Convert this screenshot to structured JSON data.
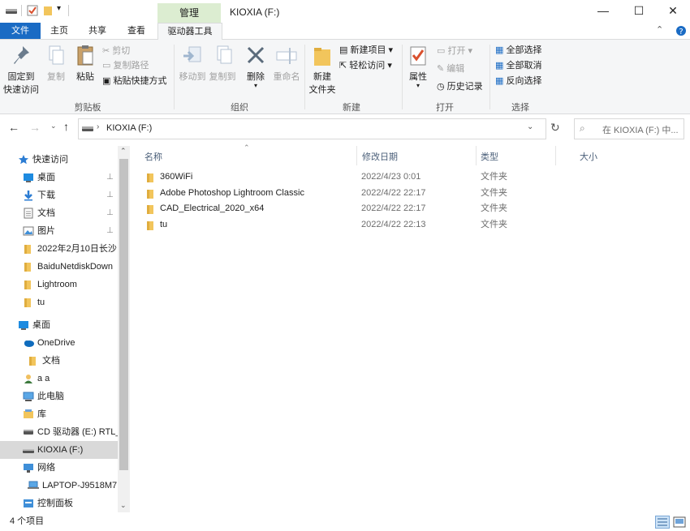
{
  "window": {
    "title": "KIOXIA (F:)",
    "context_tab": "管理"
  },
  "tabs": {
    "file": "文件",
    "home": "主页",
    "share": "共享",
    "view": "查看",
    "drive_tools": "驱动器工具"
  },
  "ribbon": {
    "clipboard": {
      "group": "剪贴板",
      "pin": "固定到\n快速访问",
      "pin_line1": "固定到",
      "pin_line2": "快速访问",
      "copy": "复制",
      "paste": "粘贴",
      "cut": "剪切",
      "copy_path": "复制路径",
      "paste_shortcut": "粘贴快捷方式"
    },
    "organize": {
      "group": "组织",
      "move_to": "移动到",
      "copy_to": "复制到",
      "delete": "删除",
      "rename": "重命名"
    },
    "new": {
      "group": "新建",
      "new_folder_line1": "新建",
      "new_folder_line2": "文件夹",
      "new_item": "新建项目",
      "easy_access": "轻松访问"
    },
    "open": {
      "group": "打开",
      "properties": "属性",
      "open": "打开",
      "edit": "编辑",
      "history": "历史记录"
    },
    "select": {
      "group": "选择",
      "select_all": "全部选择",
      "select_none": "全部取消",
      "invert": "反向选择"
    }
  },
  "address": {
    "path": "KIOXIA (F:)",
    "search_placeholder": "在 KIOXIA (F:) 中..."
  },
  "sidebar": {
    "items": [
      {
        "label": "快速访问",
        "icon": "star-icon"
      },
      {
        "label": "桌面",
        "icon": "desktop-icon"
      },
      {
        "label": "下载",
        "icon": "download-icon"
      },
      {
        "label": "文档",
        "icon": "document-icon"
      },
      {
        "label": "图片",
        "icon": "picture-icon"
      },
      {
        "label": "2022年2月10日长沙",
        "icon": "folder-icon"
      },
      {
        "label": "BaiduNetdiskDown",
        "icon": "folder-icon"
      },
      {
        "label": "Lightroom",
        "icon": "folder-icon"
      },
      {
        "label": "tu",
        "icon": "folder-icon"
      },
      {
        "label": "桌面",
        "icon": "desktop-icon"
      },
      {
        "label": "OneDrive",
        "icon": "cloud-icon"
      },
      {
        "label": "文档",
        "icon": "folder-icon"
      },
      {
        "label": "a a",
        "icon": "user-icon"
      },
      {
        "label": "此电脑",
        "icon": "computer-icon"
      },
      {
        "label": "库",
        "icon": "library-icon"
      },
      {
        "label": "CD 驱动器 (E:) RTL_",
        "icon": "cd-icon"
      },
      {
        "label": "KIOXIA (F:)",
        "icon": "drive-icon"
      },
      {
        "label": "网络",
        "icon": "network-icon"
      },
      {
        "label": "LAPTOP-J9518M7",
        "icon": "laptop-icon"
      },
      {
        "label": "控制面板",
        "icon": "control-panel-icon"
      }
    ]
  },
  "columns": {
    "name": "名称",
    "modified": "修改日期",
    "type": "类型",
    "size": "大小"
  },
  "files": [
    {
      "name": "360WiFi",
      "modified": "2022/4/23 0:01",
      "type": "文件夹"
    },
    {
      "name": "Adobe Photoshop Lightroom Classic",
      "modified": "2022/4/22 22:17",
      "type": "文件夹"
    },
    {
      "name": "CAD_Electrical_2020_x64",
      "modified": "2022/4/22 22:17",
      "type": "文件夹"
    },
    {
      "name": "tu",
      "modified": "2022/4/22 22:13",
      "type": "文件夹"
    }
  ],
  "status": {
    "count": "4 个项目"
  },
  "colors": {
    "file_tab": "#1a6bc4",
    "context_tab": "#dcedd1",
    "folder": "#f2c55c",
    "selection": "#d9d9d9"
  }
}
